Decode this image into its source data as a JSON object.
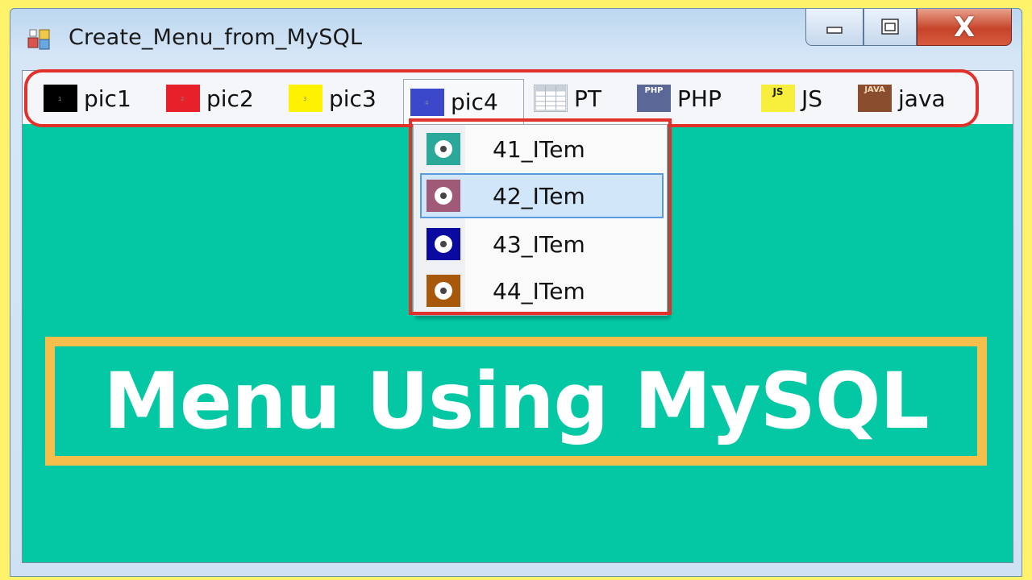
{
  "window": {
    "title": "Create_Menu_from_MySQL",
    "close_glyph": "X"
  },
  "menu": {
    "items": [
      {
        "label": "pic1",
        "icon": "black-square-icon",
        "color": "#000000"
      },
      {
        "label": "pic2",
        "icon": "red-square-icon",
        "color": "#e8202a"
      },
      {
        "label": "pic3",
        "icon": "yellow-square-icon",
        "color": "#fff200"
      },
      {
        "label": "pic4",
        "icon": "blue-square-icon",
        "color": "#3b48cc"
      },
      {
        "label": "PT",
        "icon": "table-icon",
        "color": "#ffffff"
      },
      {
        "label": "PHP",
        "icon": "php-icon",
        "color": "#5b6796",
        "icon_text": "PHP"
      },
      {
        "label": "JS",
        "icon": "js-icon",
        "color": "#f7ee3c",
        "icon_text": "JS"
      },
      {
        "label": "java",
        "icon": "java-icon",
        "color": "#8a4e2e",
        "icon_text": "JAVA"
      }
    ],
    "open_item": "pic4"
  },
  "dropdown": {
    "items": [
      {
        "label": "41_ITem",
        "icon_color": "#2aa89a"
      },
      {
        "label": "42_ITem",
        "icon_color": "#a05a78",
        "selected": true
      },
      {
        "label": "43_ITem",
        "icon_color": "#0a0aa0"
      },
      {
        "label": "44_ITem",
        "icon_color": "#a8580a"
      }
    ]
  },
  "banner": {
    "text": "Menu Using MySQL"
  },
  "colors": {
    "client_bg": "#04c8a4",
    "highlight_red": "#e2312a",
    "banner_border": "#f6bf4c",
    "page_bg": "#fdf26a"
  }
}
